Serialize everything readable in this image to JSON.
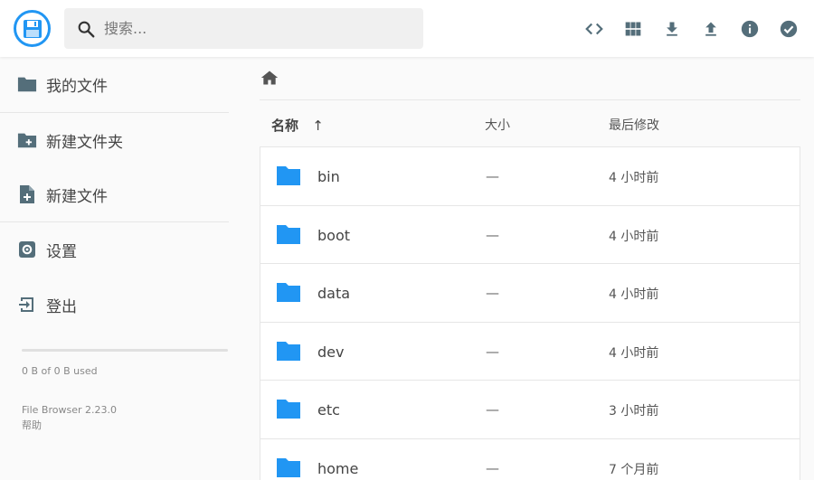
{
  "header": {
    "search_placeholder": "搜索...",
    "actions": [
      {
        "icon": "code-icon",
        "name": "view-mode-button"
      },
      {
        "icon": "grid-icon",
        "name": "switch-view-button"
      },
      {
        "icon": "download-icon",
        "name": "download-button"
      },
      {
        "icon": "upload-icon",
        "name": "upload-button"
      },
      {
        "icon": "info-icon",
        "name": "info-button"
      },
      {
        "icon": "check-circle-icon",
        "name": "select-multiple-button"
      }
    ]
  },
  "sidebar": {
    "items": [
      {
        "label": "我的文件",
        "icon": "folder-icon"
      },
      {
        "label": "新建文件夹",
        "icon": "create-folder-icon"
      },
      {
        "label": "新建文件",
        "icon": "note-add-icon"
      },
      {
        "label": "设置",
        "icon": "settings-icon"
      },
      {
        "label": "登出",
        "icon": "logout-icon"
      }
    ],
    "usage_text": "0 B of 0 B used",
    "usage_fraction": 0,
    "version": "File Browser 2.23.0",
    "help": "帮助"
  },
  "main": {
    "columns": {
      "name": "名称",
      "size": "大小",
      "modified": "最后修改"
    },
    "sort_arrow": "↑",
    "files": [
      {
        "name": "bin",
        "size": "—",
        "modified": "4 小时前"
      },
      {
        "name": "boot",
        "size": "—",
        "modified": "4 小时前"
      },
      {
        "name": "data",
        "size": "—",
        "modified": "4 小时前"
      },
      {
        "name": "dev",
        "size": "—",
        "modified": "4 小时前"
      },
      {
        "name": "etc",
        "size": "—",
        "modified": "3 小时前"
      },
      {
        "name": "home",
        "size": "—",
        "modified": "7 个月前"
      }
    ]
  },
  "colors": {
    "accent": "#2196f3",
    "icon_dark": "#546e7a",
    "folder": "#2196f3"
  }
}
